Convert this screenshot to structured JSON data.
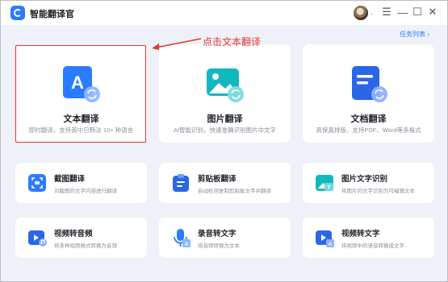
{
  "app": {
    "title": "智能翻译官"
  },
  "window_controls": {
    "menu": "☰",
    "minimize": "—",
    "maximize": "☐",
    "close": "✕"
  },
  "header": {
    "dot": ".",
    "task_list": "任务列表 ›"
  },
  "annotation": {
    "text": "点击文本翻译",
    "color": "#e8322f"
  },
  "main_cards": [
    {
      "title": "文本翻译",
      "desc": "即时翻译，支持英中日韩法 10+ 种语言",
      "icon": "text-translate-icon"
    },
    {
      "title": "图片翻译",
      "desc": "AI智能识别，快速准确识别图片中文字",
      "icon": "image-translate-icon"
    },
    {
      "title": "文档翻译",
      "desc": "高保真排版，支持PDF、Word等多格式",
      "icon": "document-translate-icon"
    }
  ],
  "tool_cards": [
    {
      "title": "截图翻译",
      "desc": "对截图的文字内容进行翻译",
      "icon": "screenshot-icon"
    },
    {
      "title": "剪贴板翻译",
      "desc": "自动检测复制剪贴板文字并翻译",
      "icon": "clipboard-icon"
    },
    {
      "title": "图片文字识别",
      "desc": "将图片的文字识别为可编辑文本",
      "icon": "ocr-icon"
    },
    {
      "title": "视频转音频",
      "desc": "将多种视频格式转换为音频",
      "icon": "video-to-audio-icon"
    },
    {
      "title": "录音转文字",
      "desc": "将音频转换为文本",
      "icon": "audio-to-text-icon"
    },
    {
      "title": "视频转文字",
      "desc": "将视频中的语音转换成文字",
      "icon": "video-to-text-icon"
    }
  ],
  "colors": {
    "accent": "#2b7bff",
    "background": "#eef1f7",
    "highlight": "#e8322f"
  }
}
